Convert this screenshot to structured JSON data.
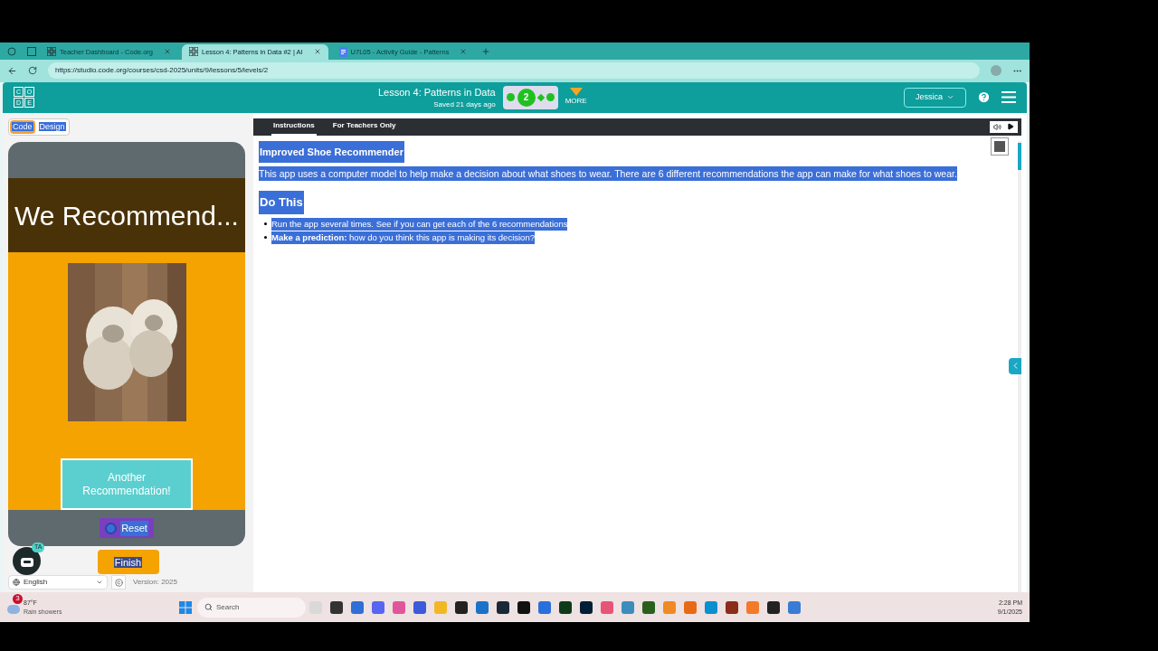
{
  "browser": {
    "tabs": [
      {
        "title": "Teacher Dashboard - Code.org",
        "selected": false,
        "kind": "grid"
      },
      {
        "title": "Lesson 4: Patterns in Data #2 | AI",
        "selected": true,
        "kind": "grid"
      },
      {
        "title": "U7L05 - Activity Guide - Patterns",
        "selected": false,
        "kind": "doc"
      }
    ],
    "url": "https://studio.code.org/courses/csd-2025/units/9/lessons/5/levels/2"
  },
  "header": {
    "logo_letters": [
      "C",
      "O",
      "D",
      "E"
    ],
    "lesson_title": "Lesson 4: Patterns in Data",
    "saved": "Saved 21 days ago",
    "progress_current": "2",
    "more": "MORE",
    "user": "Jessica"
  },
  "mode_toggle": [
    {
      "label": "Code",
      "selected": true
    },
    {
      "label": "Design",
      "selected": false
    }
  ],
  "app": {
    "title": "We Recommend...",
    "button": "Another Recommendation!",
    "reset": "Reset",
    "finish": "Finish",
    "ta_badge": "TA",
    "language": "English",
    "version": "Version: 2025"
  },
  "instructions": {
    "tabs": [
      {
        "label": "Instructions",
        "selected": true
      },
      {
        "label": "For Teachers Only",
        "selected": false
      }
    ],
    "heading": "Improved Shoe Recommender",
    "paragraph": "This app uses a computer model to help make a decision about what shoes to wear. There are 6 different recommendations the app can make for what shoes to wear.",
    "subheading": "Do This",
    "bullets": [
      "Run the app several times. See if you can get each of the 6 recommendations",
      "**Make a prediction:** how do you think this app is making its decision?"
    ]
  },
  "taskbar": {
    "notification_count": "3",
    "temperature": "87°F",
    "weather": "Rain showers",
    "search_placeholder": "Search",
    "apps": [
      {
        "color": "#d9d9d9"
      },
      {
        "color": "#333333"
      },
      {
        "color": "#2f6fd6"
      },
      {
        "color": "#5865f2"
      },
      {
        "color": "#e0569b"
      },
      {
        "color": "#3b5bdb"
      },
      {
        "color": "#f2b824"
      },
      {
        "color": "#222222"
      },
      {
        "color": "#1a73c8"
      },
      {
        "color": "#1b2838"
      },
      {
        "color": "#111111"
      },
      {
        "color": "#2a6fdb"
      },
      {
        "color": "#0d3b1a"
      },
      {
        "color": "#001e36"
      },
      {
        "color": "#e8537a"
      },
      {
        "color": "#3c8dbc"
      },
      {
        "color": "#2c5f1e"
      },
      {
        "color": "#f08a24"
      },
      {
        "color": "#e86a17"
      },
      {
        "color": "#0c8fd0"
      },
      {
        "color": "#8a2d1a"
      },
      {
        "color": "#f5792a"
      },
      {
        "color": "#222222"
      },
      {
        "color": "#3a7bd5"
      }
    ],
    "time": "2:28 PM",
    "date": "9/1/2025"
  }
}
